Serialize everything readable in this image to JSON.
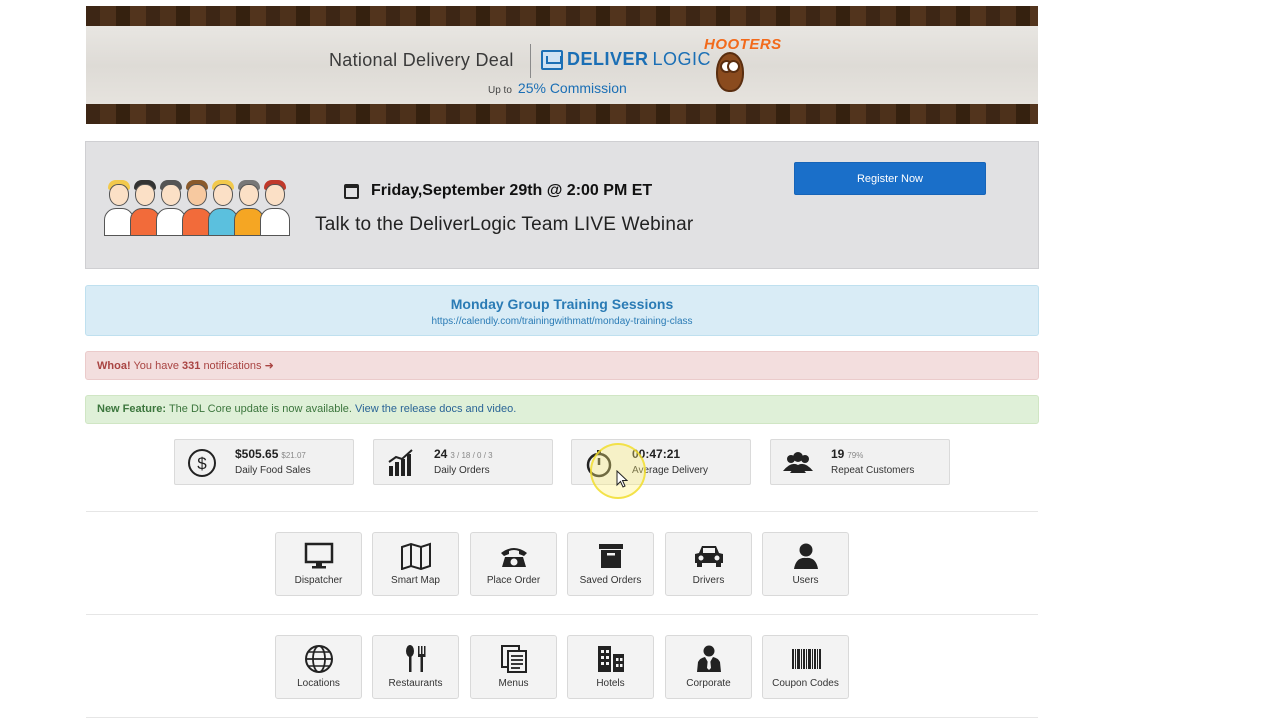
{
  "hooters_banner": {
    "title": "National Delivery Deal",
    "logo_strong": "DELIVER",
    "logo_light": "LOGIC",
    "brand": "HOOTERS",
    "upto": "Up to",
    "commission": "25% Commission"
  },
  "webinar": {
    "date": "Friday,September 29th @ 2:00 PM ET",
    "title": "Talk  to the DeliverLogic Team LIVE Webinar",
    "register_label": "Register Now"
  },
  "training": {
    "title": "Monday Group Training Sessions",
    "link": "https://calendly.com/trainingwithmatt/monday-training-class"
  },
  "notifications": {
    "prefix": "Whoa!",
    "text_before": "You have",
    "count": "331",
    "text_after": "notifications",
    "arrow": "➜"
  },
  "feature": {
    "label": "New Feature:",
    "text": "The DL Core update is now available.",
    "link": "View the release docs and video."
  },
  "stats": [
    {
      "value": "$505.65",
      "sub": "$21.07",
      "label": "Daily Food Sales",
      "icon": "dollar-icon"
    },
    {
      "value": "24",
      "sub": "3 / 18 / 0 / 3",
      "label": "Daily Orders",
      "icon": "bar-chart-icon"
    },
    {
      "value": "00:47:21",
      "sub": "",
      "label": "Average Delivery",
      "icon": "stopwatch-icon"
    },
    {
      "value": "19",
      "sub": "79%",
      "label": "Repeat Customers",
      "icon": "group-icon"
    }
  ],
  "tiles_row1": [
    {
      "label": "Dispatcher",
      "icon": "monitor-icon"
    },
    {
      "label": "Smart Map",
      "icon": "map-icon"
    },
    {
      "label": "Place Order",
      "icon": "phone-icon"
    },
    {
      "label": "Saved Orders",
      "icon": "archive-icon"
    },
    {
      "label": "Drivers",
      "icon": "car-icon"
    },
    {
      "label": "Users",
      "icon": "user-icon"
    }
  ],
  "tiles_row2": [
    {
      "label": "Locations",
      "icon": "globe-icon"
    },
    {
      "label": "Restaurants",
      "icon": "cutlery-icon"
    },
    {
      "label": "Menus",
      "icon": "documents-icon"
    },
    {
      "label": "Hotels",
      "icon": "buildings-icon"
    },
    {
      "label": "Corporate",
      "icon": "businessman-icon"
    },
    {
      "label": "Coupon Codes",
      "icon": "barcode-icon"
    }
  ]
}
